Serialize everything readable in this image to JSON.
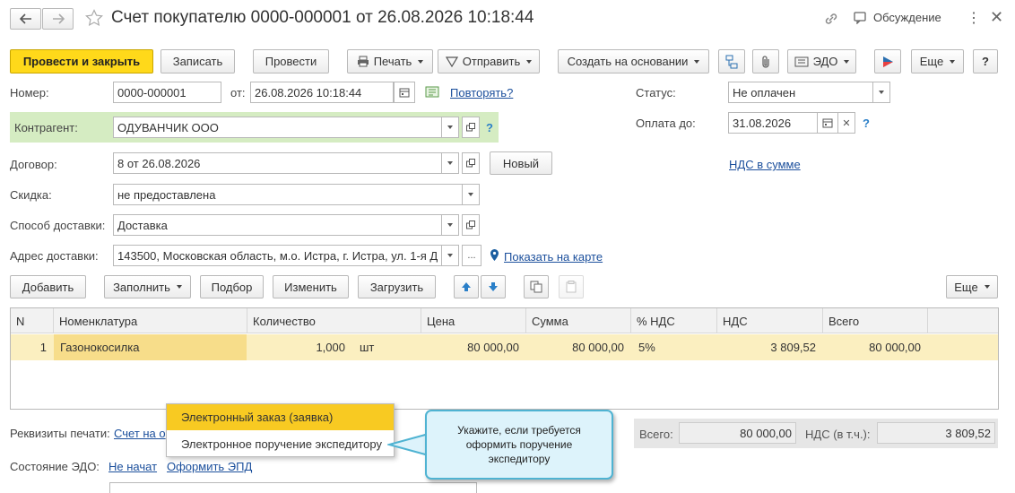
{
  "window": {
    "title": "Счет покупателю 0000-000001 от 26.08.2026 10:18:44",
    "discussion": "Обсуждение"
  },
  "toolbar": {
    "post_close": "Провести и закрыть",
    "save": "Записать",
    "post": "Провести",
    "print": "Печать",
    "send": "Отправить",
    "create_based": "Создать на основании",
    "edo": "ЭДО",
    "more": "Еще",
    "help": "?"
  },
  "form": {
    "number_label": "Номер:",
    "number_value": "0000-000001",
    "date_label": "от:",
    "date_value": "26.08.2026 10:18:44",
    "repeat_link": "Повторять?",
    "status_label": "Статус:",
    "status_value": "Не оплачен",
    "pay_until_label": "Оплата до:",
    "pay_until_value": "31.08.2026",
    "counterparty_label": "Контрагент:",
    "counterparty_value": "ОДУВАНЧИК ООО",
    "contract_label": "Договор:",
    "contract_value": "8 от 26.08.2026",
    "new_button": "Новый",
    "vat_link": "НДС в сумме",
    "discount_label": "Скидка:",
    "discount_value": "не предоставлена",
    "delivery_method_label": "Способ доставки:",
    "delivery_method_value": "Доставка",
    "delivery_address_label": "Адрес доставки:",
    "delivery_address_value": "143500, Московская область, м.о. Истра, г. Истра, ул. 1-я Д",
    "ellipsis": "...",
    "show_on_map": "Показать на карте",
    "question": "?"
  },
  "table_toolbar": {
    "add": "Добавить",
    "fill": "Заполнить",
    "pick": "Подбор",
    "change": "Изменить",
    "load": "Загрузить",
    "more": "Еще"
  },
  "table": {
    "headers": [
      "N",
      "Номенклатура",
      "Количество",
      "Цена",
      "Сумма",
      "% НДС",
      "НДС",
      "Всего"
    ],
    "rows": [
      {
        "n": "1",
        "item": "Газонокосилка",
        "qty": "1,000",
        "unit": "шт",
        "price": "80 000,00",
        "sum": "80 000,00",
        "vat_rate": "5%",
        "vat": "3 809,52",
        "total": "80 000,00"
      }
    ]
  },
  "footer": {
    "print_details_label": "Реквизиты печати:",
    "print_details_link": "Счет на о",
    "edo_state_label": "Состояние ЭДО:",
    "edo_state_link": "Не начат",
    "edo_action_link": "Оформить ЭПД",
    "total_label": "Всего:",
    "total_value": "80 000,00",
    "vat_incl_label": "НДС (в т.ч.):",
    "vat_incl_value": "3 809,52"
  },
  "popup": {
    "items": [
      "Электронный заказ (заявка)",
      "Электронное поручение экспедитору"
    ]
  },
  "callout": {
    "text": "Укажите, если требуется оформить поручение экспедитору"
  },
  "colors": {
    "accent": "#ffd91a",
    "highlight_row": "#fbefc0",
    "link": "#1b4f9c",
    "callout_bg": "#ddf3fb",
    "callout_border": "#4fb3d2",
    "counterparty_bg": "#d5ecc2"
  }
}
